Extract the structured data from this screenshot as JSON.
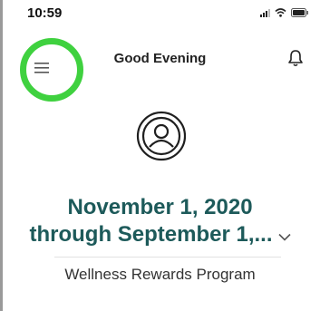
{
  "status_bar": {
    "time": "10:59",
    "icons": [
      "signal-icon",
      "wifi-icon",
      "battery-icon"
    ]
  },
  "header": {
    "greeting": "Good Evening",
    "menu_icon": "hamburger-menu-icon",
    "bell_icon": "bell-icon"
  },
  "profile": {
    "avatar_icon": "user-avatar-icon"
  },
  "period": {
    "line1": "November 1, 2020",
    "line2": "through September 1,...",
    "dropdown_icon": "chevron-down-icon"
  },
  "program": {
    "name": "Wellness Rewards Program"
  },
  "colors": {
    "accent": "#1d5a5a",
    "highlight": "#3fd13f",
    "divider": "#e2e2e2"
  }
}
